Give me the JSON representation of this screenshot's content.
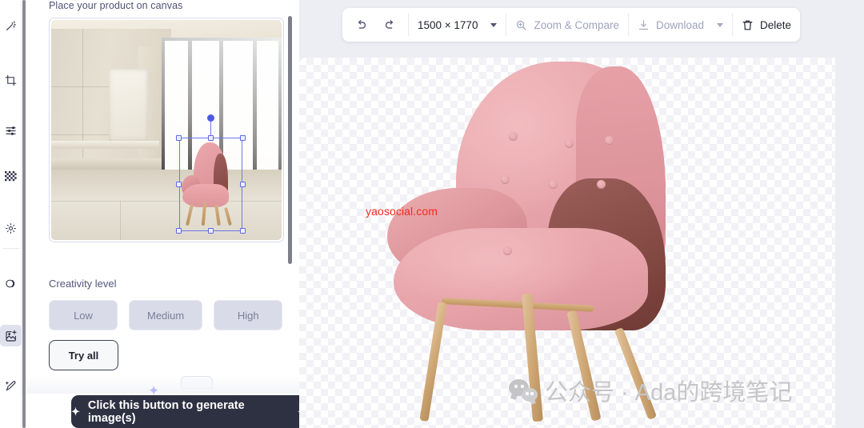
{
  "rail": {
    "items": [
      {
        "name": "magic-wand-icon",
        "label": "Magic enhance",
        "active": false
      },
      {
        "name": "crop-icon",
        "label": "Crop",
        "active": false
      },
      {
        "name": "adjustments-icon",
        "label": "Adjust",
        "active": false
      },
      {
        "name": "background-pattern-icon",
        "label": "Background",
        "active": false
      },
      {
        "name": "lighting-icon",
        "label": "Lighting",
        "active": false
      },
      {
        "name": "contrast-icon",
        "label": "Contrast",
        "active": false
      },
      {
        "name": "image-plus-icon",
        "label": "Place product on canvas",
        "active": true
      },
      {
        "name": "pen-edit-icon",
        "label": "Edit",
        "active": false
      }
    ]
  },
  "panel": {
    "heading": "Place your product on canvas",
    "creativity": {
      "title": "Creativity level",
      "options": [
        "Low",
        "Medium",
        "High"
      ],
      "try_all_label": "Try all"
    },
    "generate_button": "Click this button to generate image(s)"
  },
  "toolbar": {
    "undo_icon": "undo-icon",
    "redo_icon": "redo-icon",
    "dimensions": "1500 × 1770",
    "zoom_compare": "Zoom & Compare",
    "download": "Download",
    "delete": "Delete"
  },
  "canvas": {
    "watermark_url": "yaosocial.com",
    "watermark_wechat": "公众号 · Ada的跨境笔记"
  },
  "colors": {
    "workspace_bg": "#eceef4",
    "panel_bg": "#ffffff",
    "cta_bg": "#2e3142",
    "selection": "#6e77ec",
    "watermark_red": "#ef2b20",
    "muted_text": "#9ea3bd"
  }
}
